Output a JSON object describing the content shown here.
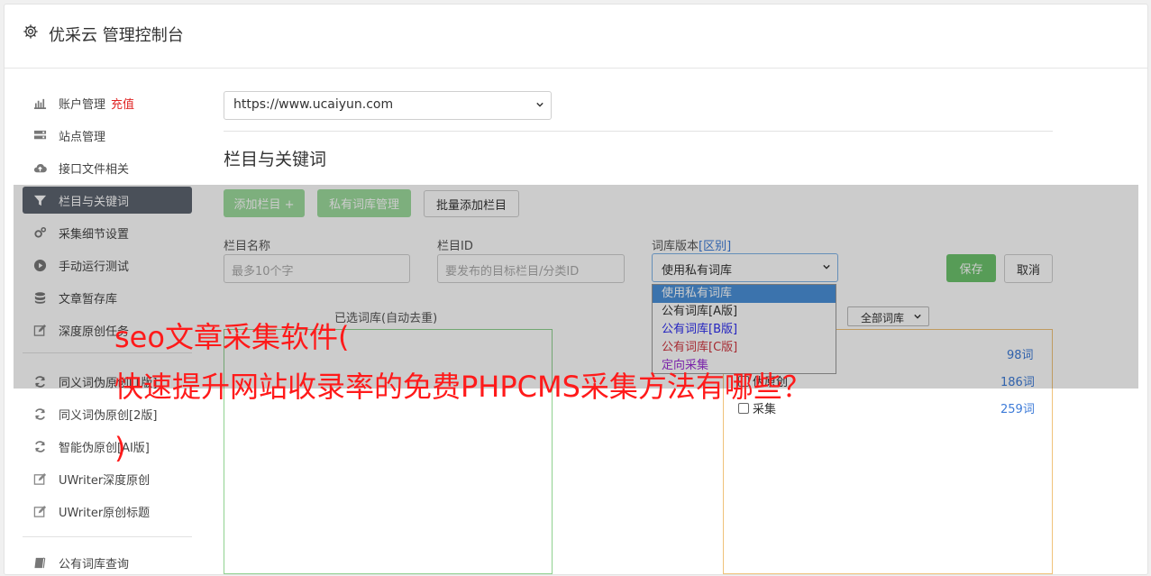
{
  "header": {
    "title": "优采云 管理控制台",
    "icon": "gear-icon"
  },
  "sidebar": {
    "recharge_label": "充值",
    "items": [
      {
        "label": "账户管理",
        "icon": "bar-chart-icon"
      },
      {
        "label": "站点管理",
        "icon": "server-icon"
      },
      {
        "label": "接口文件相关",
        "icon": "cloud-upload-icon"
      },
      {
        "label": "栏目与关键词",
        "icon": "filter-icon"
      },
      {
        "label": "采集细节设置",
        "icon": "cogs-icon"
      },
      {
        "label": "手动运行测试",
        "icon": "play-circle-icon"
      },
      {
        "label": "文章暂存库",
        "icon": "database-icon"
      },
      {
        "label": "深度原创任务",
        "icon": "edit-icon"
      },
      {
        "label": "同义词伪原创[1版]",
        "icon": "refresh-icon"
      },
      {
        "label": "同义词伪原创[2版]",
        "icon": "refresh-icon"
      },
      {
        "label": "智能伪原创[AI版]",
        "icon": "refresh-icon"
      },
      {
        "label": "UWriter深度原创",
        "icon": "edit-icon"
      },
      {
        "label": "UWriter原创标题",
        "icon": "edit-icon"
      },
      {
        "label": "公有词库查询",
        "icon": "book-icon"
      }
    ]
  },
  "main": {
    "site_select": "https://www.ucaiyun.com",
    "section_title": "栏目与关键词",
    "buttons": {
      "add_column": "添加栏目 +",
      "private_lib": "私有词库管理",
      "batch_add": "批量添加栏目"
    },
    "form": {
      "name_label": "栏目名称",
      "name_placeholder": "最多10个字",
      "id_label": "栏目ID",
      "id_placeholder": "要发布的目标栏目/分类ID",
      "lib_label": "词库版本",
      "lib_diff": "[区别]",
      "lib_selected": "使用私有词库",
      "save": "保存",
      "cancel": "取消"
    },
    "dropdown_options": [
      {
        "label": "使用私有词库",
        "color": "#ffffff"
      },
      {
        "label": "公有词库[A版]",
        "color": "#333333"
      },
      {
        "label": "公有词库[B版]",
        "color": "#2d2df0"
      },
      {
        "label": "公有词库[C版]",
        "color": "#d0363f"
      },
      {
        "label": "定向采集",
        "color": "#9b2fd6"
      }
    ],
    "left_box_label": "已选词库(自动去重)",
    "filter_select": "全部词库",
    "lib_rows": [
      {
        "label": "",
        "count": "98词"
      },
      {
        "label": "伪原创",
        "count": "186词"
      },
      {
        "label": "采集",
        "count": "259词"
      }
    ]
  },
  "watermark": {
    "line1": "seo文章采集软件(",
    "line2": "快速提升网站收录率的免费PHPCMS采集方法有哪些？",
    "line3": ")"
  },
  "colors": {
    "active_bg": "#5d6470",
    "accent_blue": "#3d7bd8",
    "recharge_red": "#e02424",
    "watermark_red": "#ff1a1a"
  }
}
